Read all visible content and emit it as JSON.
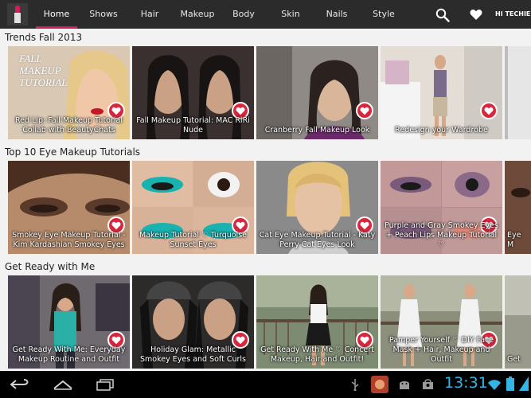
{
  "header": {
    "tabs": [
      "Home",
      "Shows",
      "Hair",
      "Makeup",
      "Body",
      "Skin",
      "Nails",
      "Style"
    ],
    "user_label": "HI TECHIE"
  },
  "sections": [
    {
      "title": "Trends Fall 2013",
      "cards": [
        {
          "caption": "Red Lip: Fall Makeup Tutorial Collab with BeautyChats",
          "thumb_text": "FALL MAKEUP TUTORIAL",
          "color": "#d9c9b4"
        },
        {
          "caption": "Fall Makeup Tutorial: MAC RiRi Nude",
          "color": "#3a3030"
        },
        {
          "caption": "Cranberry Fall Makeup Look",
          "color": "#8f8a86"
        },
        {
          "caption": "Redesign your Wardrobe",
          "color": "#cfc7bf"
        },
        {
          "caption": "",
          "color": "#e6e6e6"
        }
      ]
    },
    {
      "title": "Top 10 Eye Makeup Tutorials",
      "cards": [
        {
          "caption": "Smokey Eye Makeup Tutorial - Kim Kardashian Smokey Eyes",
          "color": "#b58b6c"
        },
        {
          "caption": "Makeup Tutorial ♡ Turquoise Sunset Eyes",
          "color": "#d9b49a"
        },
        {
          "caption": "Cat Eye Makeup Tutorial - Katy Perry Cat Eyes Look",
          "color": "#d5b792"
        },
        {
          "caption": "Purple and Gray Smokey Eyes + Peach Lips Makeup Tutorial ♡",
          "color": "#b88a8e"
        },
        {
          "caption": "Eye M",
          "color": "#6d4a3a"
        }
      ]
    },
    {
      "title": "Get Ready with Me",
      "cards": [
        {
          "caption": "Get Ready With Me: Everyday Makeup Routine and Outfit",
          "color": "#6f6a6f"
        },
        {
          "caption": "Holiday Glam: Metallic Smokey Eyes and Soft Curls",
          "color": "#2d2a2a"
        },
        {
          "caption": "Get Ready With Me ♡ Concert Makeup, Hair and Outfit!",
          "color": "#7d8b72"
        },
        {
          "caption": "Pamper Yourself ♡ DIY Face Mask + Hair, Makeup and Outfit",
          "color": "#8c8f7c"
        },
        {
          "caption": "Get",
          "color": "#9a9a8c"
        }
      ]
    }
  ],
  "status_bar": {
    "time": "13:31"
  },
  "colors": {
    "accent": "#d51c5a",
    "fav": "#d7263d",
    "clock": "#33b5e5",
    "topbar": "#2b2b2b"
  }
}
